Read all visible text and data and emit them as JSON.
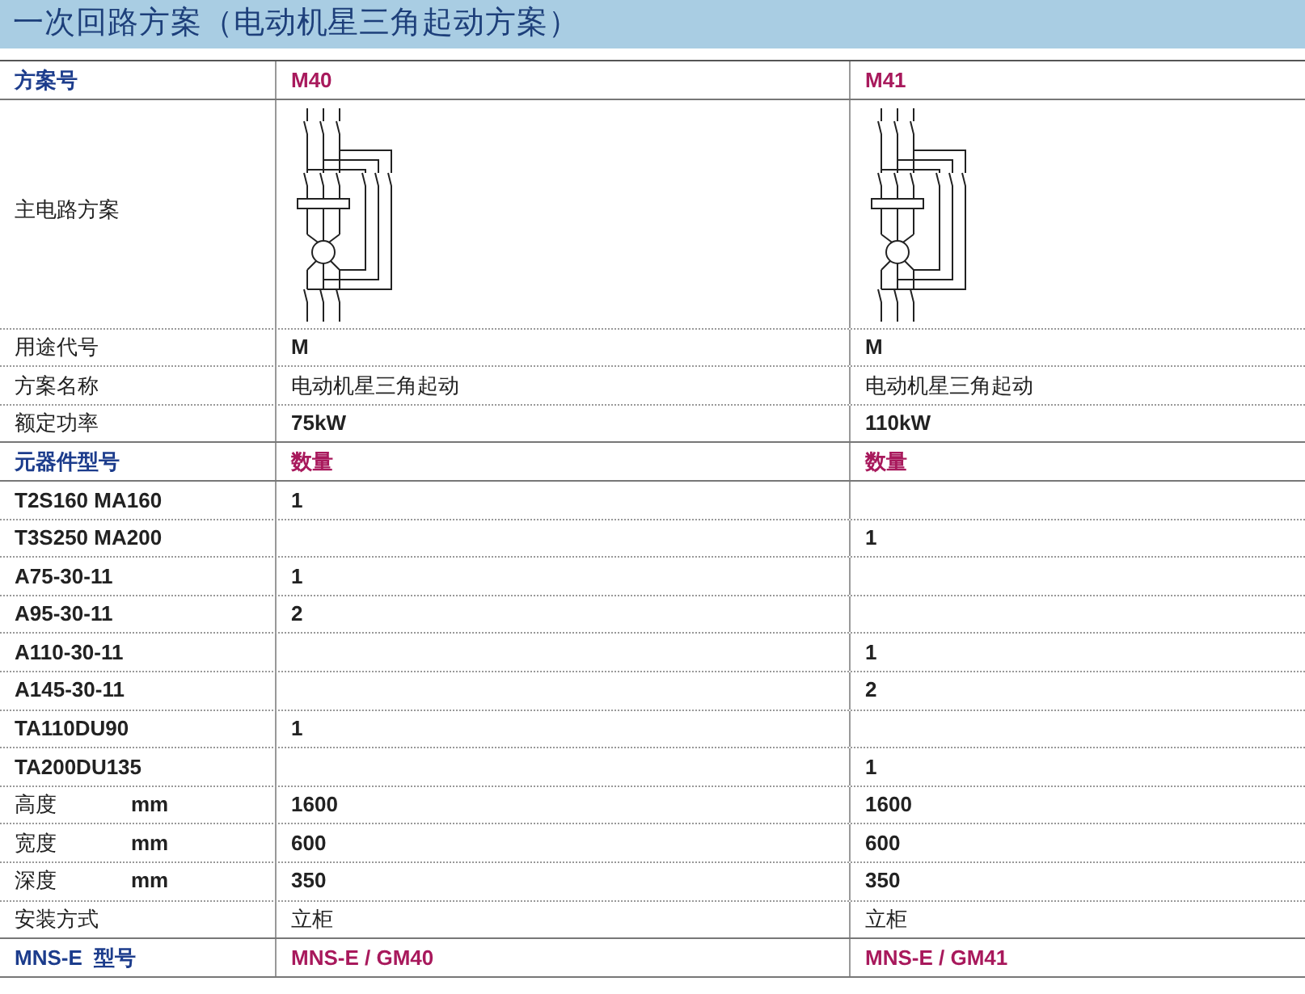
{
  "title": "一次回路方案（电动机星三角起动方案）",
  "rows": [
    {
      "kind": "header",
      "label": "方案号",
      "values": [
        "M40",
        "M41"
      ]
    },
    {
      "kind": "diagram",
      "label": "主电路方案"
    },
    {
      "kind": "field",
      "label": "用途代号",
      "values": [
        "M",
        "M"
      ]
    },
    {
      "kind": "text",
      "label": "方案名称",
      "values": [
        "电动机星三角起动",
        "电动机星三角起动"
      ]
    },
    {
      "kind": "field",
      "label": "额定功率",
      "values": [
        "75kW",
        "110kW"
      ]
    },
    {
      "kind": "header",
      "label": "元器件型号",
      "values": [
        "数量",
        "数量"
      ]
    },
    {
      "kind": "part",
      "label": "T2S160 MA160",
      "m40": "1"
    },
    {
      "kind": "part",
      "label": "T3S250 MA200",
      "m41": "1"
    },
    {
      "kind": "part",
      "label": "A75-30-11",
      "m40": "1"
    },
    {
      "kind": "part",
      "label": "A95-30-11",
      "m40": "2"
    },
    {
      "kind": "part",
      "label": "A110-30-11",
      "m41": "1"
    },
    {
      "kind": "part",
      "label": "A145-30-11",
      "m41": "2"
    },
    {
      "kind": "part",
      "label": "TA110DU90",
      "m40": "1"
    },
    {
      "kind": "part",
      "label": "TA200DU135",
      "m41": "1"
    },
    {
      "kind": "dimension",
      "label": "高度",
      "unit": "mm",
      "values": [
        "1600",
        "1600"
      ]
    },
    {
      "kind": "dimension",
      "label": "宽度",
      "unit": "mm",
      "values": [
        "600",
        "600"
      ]
    },
    {
      "kind": "dimension",
      "label": "深度",
      "unit": "mm",
      "values": [
        "350",
        "350"
      ]
    },
    {
      "kind": "text",
      "label": "安装方式",
      "values": [
        "立柜",
        "立柜"
      ]
    },
    {
      "kind": "footer",
      "label": "MNS-E  型号",
      "values": [
        "MNS-E / GM40",
        "MNS-E / GM41"
      ]
    }
  ]
}
